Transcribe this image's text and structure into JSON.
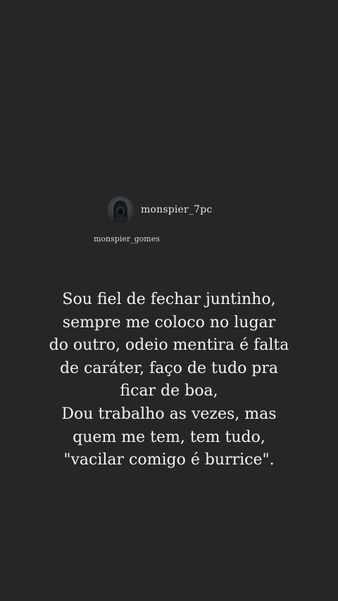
{
  "story": {
    "account": {
      "avatar_icon": "hooded-figure-avatar",
      "username": "monspier_7pc"
    },
    "mention": "monspier_gomes",
    "quote_lines": [
      "Sou fiel de fechar juntinho,",
      "sempre me coloco no lugar",
      "do outro, odeio mentira é falta",
      "de caráter, faço de tudo pra",
      "ficar de boa,",
      "Dou trabalho as vezes, mas",
      "quem me tem, tem tudo,",
      "\"vacilar comigo é burrice\"."
    ]
  },
  "colors": {
    "background": "#262626",
    "text": "#f4f4f4"
  }
}
